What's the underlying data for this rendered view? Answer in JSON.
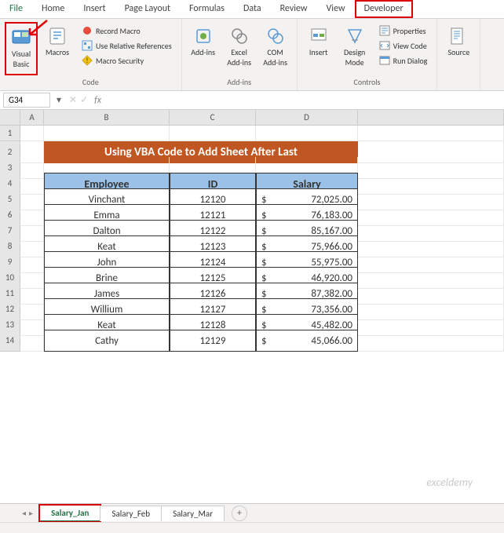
{
  "ribbon": {
    "tabs": [
      "File",
      "Home",
      "Insert",
      "Page Layout",
      "Formulas",
      "Data",
      "Review",
      "View",
      "Developer"
    ],
    "active_tab": "Developer",
    "code_group": {
      "label": "Code",
      "visual_basic": "Visual Basic",
      "macros": "Macros",
      "record_macro": "Record Macro",
      "use_relative": "Use Relative References",
      "macro_security": "Macro Security"
    },
    "addins_group": {
      "label": "Add-ins",
      "addins": "Add-ins",
      "excel_addins": "Excel Add-ins",
      "com_addins": "COM Add-ins"
    },
    "controls_group": {
      "label": "Controls",
      "insert": "Insert",
      "design_mode": "Design Mode",
      "properties": "Properties",
      "view_code": "View Code",
      "run_dialog": "Run Dialog"
    },
    "xml_group": {
      "source": "Source"
    }
  },
  "namebox": "G34",
  "fx_label": "fx",
  "columns": [
    "A",
    "B",
    "C",
    "D"
  ],
  "rows": [
    "1",
    "2",
    "3",
    "4",
    "5",
    "6",
    "7",
    "8",
    "9",
    "10",
    "11",
    "12",
    "13",
    "14"
  ],
  "title": "Using VBA Code to Add Sheet After Last",
  "headers": {
    "employee": "Employee",
    "id": "ID",
    "salary": "Salary"
  },
  "currency_symbol": "$",
  "chart_data": {
    "type": "table",
    "columns": [
      "Employee",
      "ID",
      "Salary"
    ],
    "rows": [
      {
        "employee": "Vinchant",
        "id": "12120",
        "salary": "72,025.00"
      },
      {
        "employee": "Emma",
        "id": "12121",
        "salary": "76,183.00"
      },
      {
        "employee": "Dalton",
        "id": "12122",
        "salary": "85,167.00"
      },
      {
        "employee": "Keat",
        "id": "12123",
        "salary": "75,966.00"
      },
      {
        "employee": "John",
        "id": "12124",
        "salary": "55,975.00"
      },
      {
        "employee": "Brine",
        "id": "12125",
        "salary": "46,920.00"
      },
      {
        "employee": "James",
        "id": "12126",
        "salary": "87,382.00"
      },
      {
        "employee": "Willium",
        "id": "12127",
        "salary": "73,356.00"
      },
      {
        "employee": "Keat",
        "id": "12128",
        "salary": "45,482.00"
      },
      {
        "employee": "Cathy",
        "id": "12129",
        "salary": "45,066.00"
      }
    ]
  },
  "watermark": "exceldemy",
  "sheets": [
    "Salary_Jan",
    "Salary_Feb",
    "Salary_Mar"
  ],
  "active_sheet": "Salary_Jan",
  "add_sheet": "+"
}
